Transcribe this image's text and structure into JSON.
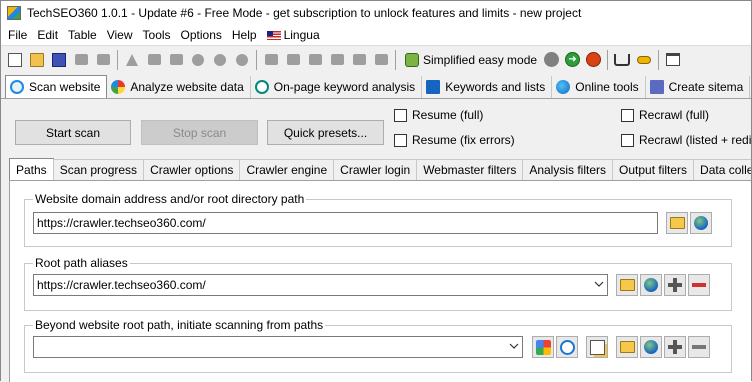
{
  "title": "TechSEO360 1.0.1 - Update #6 - Free Mode - get subscription to unlock features and limits - new project",
  "menu": [
    "File",
    "Edit",
    "Table",
    "View",
    "Tools",
    "Options",
    "Help",
    "Lingua"
  ],
  "toolbar": {
    "simplified_mode_label": "Simplified easy mode"
  },
  "main_tabs": [
    {
      "label": "Scan website",
      "icon": "scan-icon"
    },
    {
      "label": "Analyze website data",
      "icon": "pie-chart-icon"
    },
    {
      "label": "On-page keyword analysis",
      "icon": "magnifier-icon"
    },
    {
      "label": "Keywords and lists",
      "icon": "list-icon"
    },
    {
      "label": "Online tools",
      "icon": "globe-icon"
    },
    {
      "label": "Create sitema",
      "icon": "sitemap-icon"
    }
  ],
  "buttons": {
    "start_scan": "Start scan",
    "stop_scan": "Stop scan",
    "quick_presets": "Quick presets..."
  },
  "checkboxes": {
    "resume_full": "Resume (full)",
    "resume_fix": "Resume (fix errors)",
    "recrawl_full": "Recrawl (full)",
    "recrawl_listed": "Recrawl (listed + redir"
  },
  "sub_tabs": [
    "Paths",
    "Scan progress",
    "Crawler options",
    "Crawler engine",
    "Crawler login",
    "Webmaster filters",
    "Analysis filters",
    "Output filters",
    "Data collect"
  ],
  "groups": {
    "domain": {
      "title": "Website domain address and/or root directory path",
      "value": "https://crawler.techseo360.com/"
    },
    "aliases": {
      "title": "Root path aliases",
      "value": "https://crawler.techseo360.com/"
    },
    "beyond": {
      "title": "Beyond website root path, initiate scanning from paths",
      "value": ""
    }
  }
}
